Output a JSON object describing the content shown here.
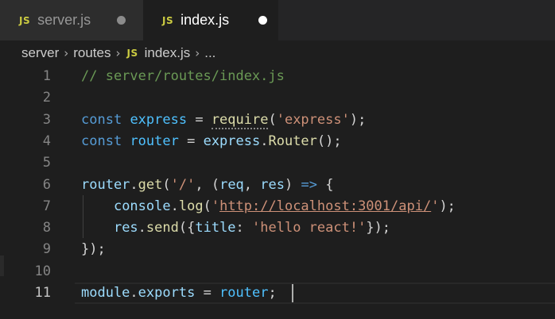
{
  "tabs": [
    {
      "icon": "JS",
      "label": "server.js",
      "state": "inactive",
      "dirty": true
    },
    {
      "icon": "JS",
      "label": "index.js",
      "state": "active",
      "dirty": true
    }
  ],
  "breadcrumb": {
    "parts": [
      "server",
      "routes"
    ],
    "file_icon": "JS",
    "file": "index.js",
    "ellipsis": "..."
  },
  "code": {
    "line_numbers": [
      "1",
      "2",
      "3",
      "4",
      "5",
      "6",
      "7",
      "8",
      "9",
      "10",
      "11"
    ],
    "current_line": 11,
    "lines": [
      [
        {
          "t": "// server/routes/index.js",
          "c": "comment"
        }
      ],
      [],
      [
        {
          "t": "const",
          "c": "kw"
        },
        {
          "t": " ",
          "c": "punc"
        },
        {
          "t": "express",
          "c": "const"
        },
        {
          "t": " = ",
          "c": "punc"
        },
        {
          "t": "require",
          "c": "fn"
        },
        {
          "t": "(",
          "c": "punc"
        },
        {
          "t": "'express'",
          "c": "str"
        },
        {
          "t": ");",
          "c": "punc"
        }
      ],
      [
        {
          "t": "const",
          "c": "kw"
        },
        {
          "t": " ",
          "c": "punc"
        },
        {
          "t": "router",
          "c": "const"
        },
        {
          "t": " = ",
          "c": "punc"
        },
        {
          "t": "express",
          "c": "var"
        },
        {
          "t": ".",
          "c": "punc"
        },
        {
          "t": "Router",
          "c": "fn"
        },
        {
          "t": "();",
          "c": "punc"
        }
      ],
      [],
      [
        {
          "t": "router",
          "c": "var"
        },
        {
          "t": ".",
          "c": "punc"
        },
        {
          "t": "get",
          "c": "fn"
        },
        {
          "t": "(",
          "c": "punc"
        },
        {
          "t": "'/'",
          "c": "str"
        },
        {
          "t": ", (",
          "c": "punc"
        },
        {
          "t": "req",
          "c": "var"
        },
        {
          "t": ", ",
          "c": "punc"
        },
        {
          "t": "res",
          "c": "var"
        },
        {
          "t": ") ",
          "c": "punc"
        },
        {
          "t": "=>",
          "c": "kw"
        },
        {
          "t": " {",
          "c": "punc"
        }
      ],
      [
        {
          "t": "    ",
          "c": "punc"
        },
        {
          "t": "console",
          "c": "var"
        },
        {
          "t": ".",
          "c": "punc"
        },
        {
          "t": "log",
          "c": "fn"
        },
        {
          "t": "(",
          "c": "punc"
        },
        {
          "t": "'",
          "c": "str"
        },
        {
          "t": "http://localhost:3001/api/",
          "c": "url"
        },
        {
          "t": "'",
          "c": "str"
        },
        {
          "t": ");",
          "c": "punc"
        }
      ],
      [
        {
          "t": "    ",
          "c": "punc"
        },
        {
          "t": "res",
          "c": "var"
        },
        {
          "t": ".",
          "c": "punc"
        },
        {
          "t": "send",
          "c": "fn"
        },
        {
          "t": "({",
          "c": "punc"
        },
        {
          "t": "title",
          "c": "var"
        },
        {
          "t": ": ",
          "c": "punc"
        },
        {
          "t": "'hello react!'",
          "c": "str"
        },
        {
          "t": "});",
          "c": "punc"
        }
      ],
      [
        {
          "t": "});",
          "c": "punc"
        }
      ],
      [],
      [
        {
          "t": "module",
          "c": "var"
        },
        {
          "t": ".",
          "c": "punc"
        },
        {
          "t": "exports",
          "c": "var"
        },
        {
          "t": " = ",
          "c": "punc"
        },
        {
          "t": "router",
          "c": "const"
        },
        {
          "t": ";",
          "c": "punc"
        }
      ]
    ]
  },
  "colors": {
    "editor_bg": "#1e1e1e",
    "tabbar_bg": "#252526",
    "inactive_tab_bg": "#2d2d2d",
    "js_icon": "#cbcb41",
    "keyword": "#569cd6",
    "constant": "#4fc1ff",
    "variable": "#9cdcfe",
    "function": "#dcdcaa",
    "string": "#ce9178",
    "comment": "#6a9955"
  },
  "icons": [
    "js-file-icon",
    "dirty-dot-icon",
    "chevron-right-icon"
  ]
}
